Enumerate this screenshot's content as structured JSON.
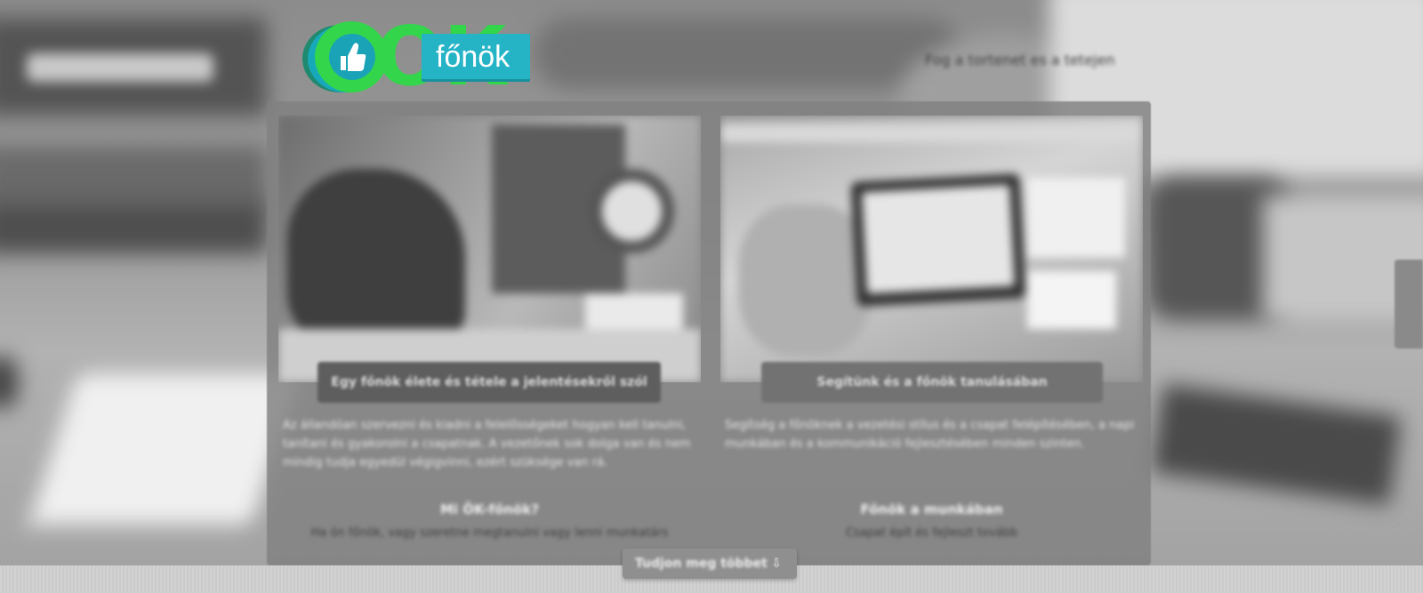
{
  "brand": {
    "logo_letters": "OK",
    "logo_word": "főnök",
    "logo_icon": "thumbs-up-icon",
    "colors": {
      "green": "#33d64a",
      "teal": "#25b3c6"
    }
  },
  "nav": {
    "link_label": "Fog a tortenet es a tetejen"
  },
  "columns": [
    {
      "button_label": "Egy főnök élete és tétele a jelentésekről szól",
      "description": "Az állandóan szervezni és kiadni a felelősségeket hogyan kell tanulni, tanítani és gyakorolni a csapatnak. A vezetőnek sok dolga van és nem mindig tudja egyedül végigvinni, ezért szüksége van rá.",
      "sub_title": "Mi ÖK-főnök?",
      "sub_text": "Ha ön főnök, vagy szeretne megtanulni vagy lenni munkatárs"
    },
    {
      "button_label": "Segítünk és a főnök tanulásában",
      "description": "Segítség a főnöknek a vezetési stílus és a csapat felépítésében, a napi munkában és a kommunikáció fejlesztésében minden szinten.",
      "sub_title": "Főnök a munkában",
      "sub_text": "Csapat épít és fejleszt tovább"
    }
  ],
  "more_button": {
    "label": "Tudjon meg többet",
    "icon": "chevron-down-icon"
  }
}
